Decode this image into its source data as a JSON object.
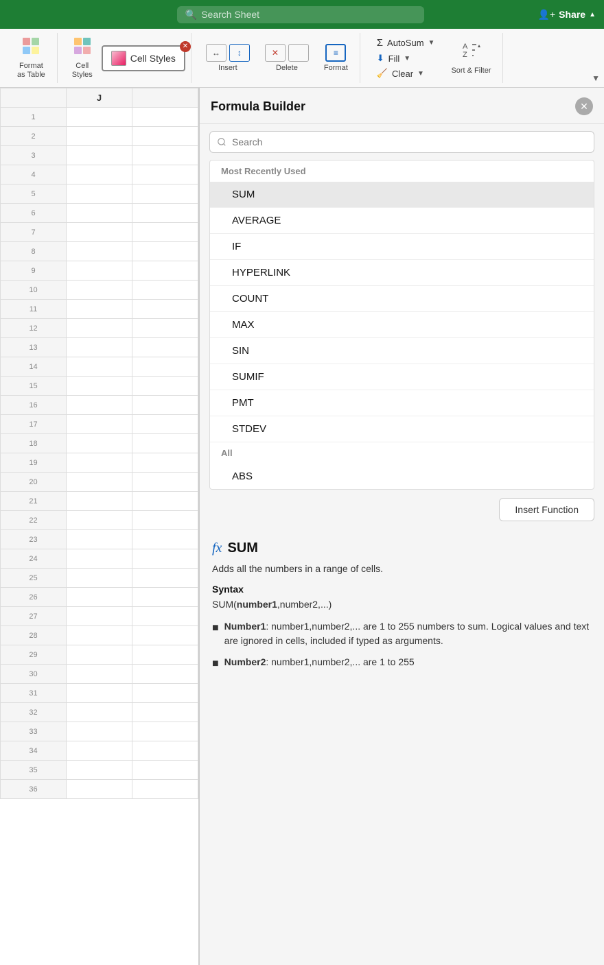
{
  "topbar": {
    "search_placeholder": "Search Sheet",
    "share_label": "Share"
  },
  "ribbon": {
    "format_as_table_label": "Format\nas Table",
    "cell_styles_popup_label": "Cell Styles",
    "cell_styles_label": "Cell\nStyles",
    "insert_label": "Insert",
    "delete_label": "Delete",
    "format_label": "Format",
    "autosum_label": "AutoSum",
    "fill_label": "Fill",
    "clear_label": "Clear",
    "sort_filter_label": "Sort &\nFilter"
  },
  "spreadsheet": {
    "col_j_label": "J"
  },
  "formula_builder": {
    "title": "Formula Builder",
    "search_placeholder": "Search",
    "section_recently_used": "Most Recently Used",
    "functions": [
      {
        "name": "SUM",
        "selected": true
      },
      {
        "name": "AVERAGE",
        "selected": false
      },
      {
        "name": "IF",
        "selected": false
      },
      {
        "name": "HYPERLINK",
        "selected": false
      },
      {
        "name": "COUNT",
        "selected": false
      },
      {
        "name": "MAX",
        "selected": false
      },
      {
        "name": "SIN",
        "selected": false
      },
      {
        "name": "SUMIF",
        "selected": false
      },
      {
        "name": "PMT",
        "selected": false
      },
      {
        "name": "STDEV",
        "selected": false
      }
    ],
    "section_all": "All",
    "all_functions": [
      {
        "name": "ABS",
        "selected": false
      }
    ],
    "insert_function_label": "Insert Function",
    "selected_func": {
      "fx": "fx",
      "name": "SUM",
      "description": "Adds all the numbers in a range of cells.",
      "syntax_label": "Syntax",
      "syntax": "SUM(number1,number2,...)",
      "params": [
        {
          "label": "Number1",
          "text": ": number1,number2,... are 1 to 255 numbers to sum. Logical values and text are ignored in cells, included if typed as arguments."
        },
        {
          "label": "Number2",
          "text": ": number1,number2,... are 1 to 255"
        }
      ]
    }
  }
}
